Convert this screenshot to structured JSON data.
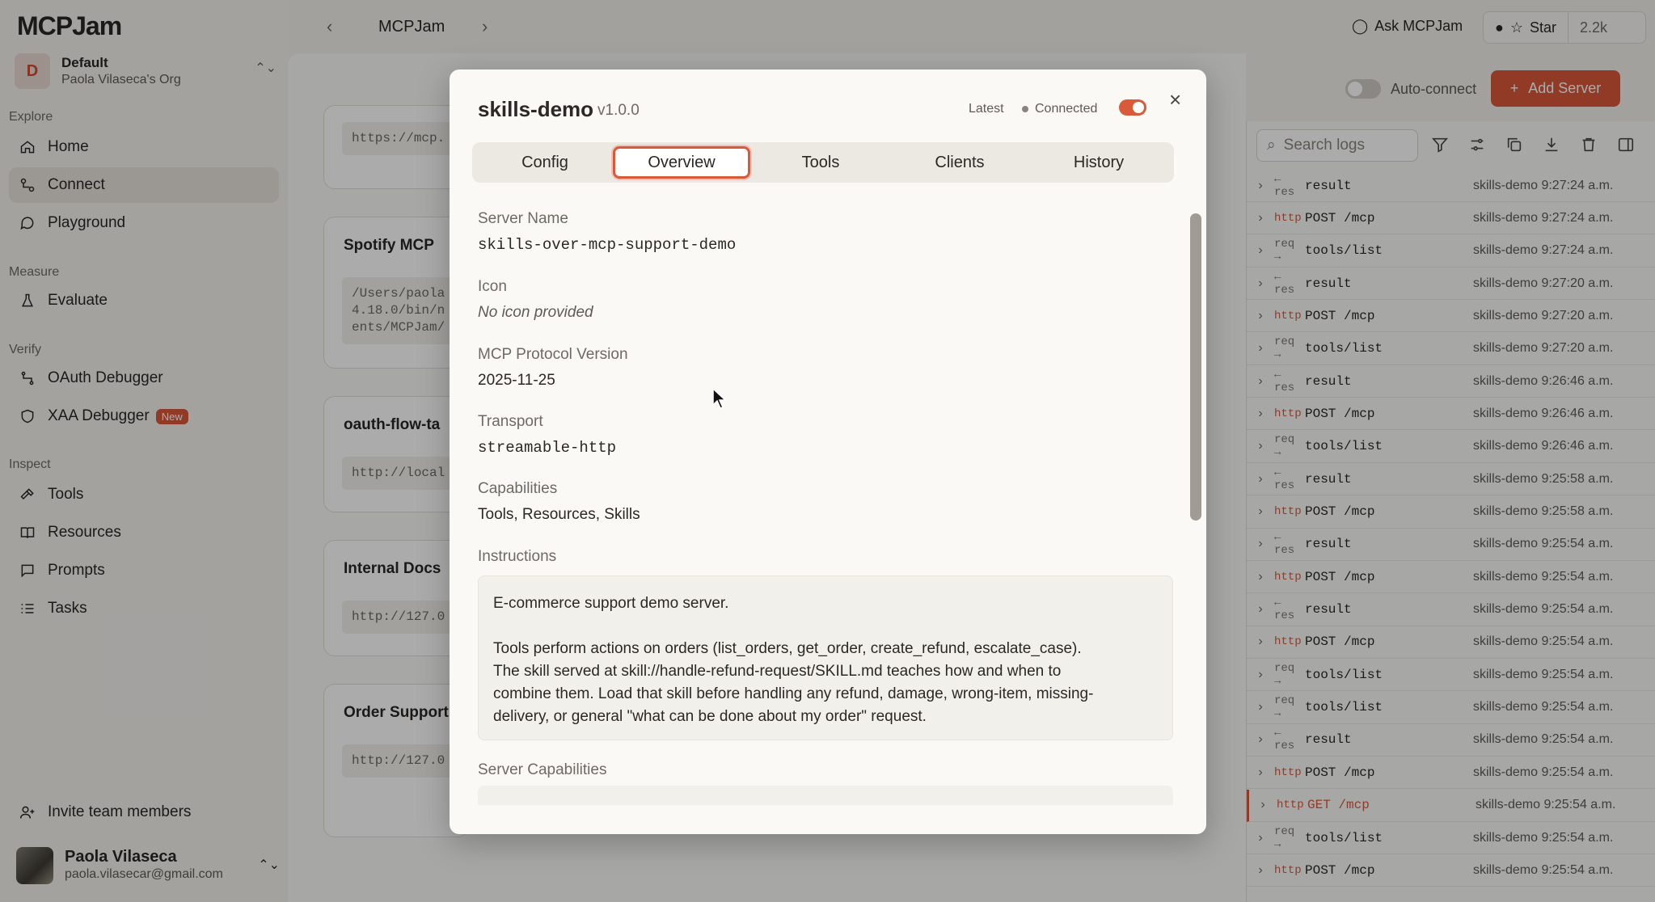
{
  "app": {
    "logo": "MCPJam",
    "org": {
      "initial": "D",
      "name": "Default",
      "owner": "Paola Vilaseca's Org"
    },
    "nav": {
      "explore_label": "Explore",
      "home": "Home",
      "connect": "Connect",
      "playground": "Playground",
      "measure_label": "Measure",
      "evaluate": "Evaluate",
      "verify_label": "Verify",
      "oauth_debugger": "OAuth Debugger",
      "xaa_debugger": "XAA Debugger",
      "new_badge": "New",
      "inspect_label": "Inspect",
      "tools": "Tools",
      "resources": "Resources",
      "prompts": "Prompts",
      "tasks": "Tasks",
      "invite": "Invite team members"
    },
    "user": {
      "name": "Paola Vilaseca",
      "email": "paola.vilasecar@gmail.com"
    }
  },
  "topbar": {
    "breadcrumb": "MCPJam",
    "ask_label": "Ask MCPJam",
    "star_label": "Star",
    "star_count": "2.2k"
  },
  "main": {
    "auto_connect_label": "Auto-connect",
    "add_server_label": "Add Server",
    "cards": [
      {
        "title": "",
        "code": "https://mcp."
      },
      {
        "title": "Spotify MCP",
        "code": "/Users/paola\n4.18.0/bin/n\nents/MCPJam/"
      },
      {
        "title": "oauth-flow-ta",
        "code": "http://local"
      },
      {
        "title": "Internal Docs",
        "code": "http://127.0"
      },
      {
        "title": "Order Support",
        "code": "http://127.0"
      }
    ]
  },
  "modal": {
    "server_title": "skills-demo",
    "version": "v1.0.0",
    "latest_label": "Latest",
    "status_label": "Connected",
    "tabs": [
      "Config",
      "Overview",
      "Tools",
      "Clients",
      "History"
    ],
    "active_tab": "Overview",
    "fields": {
      "server_name_label": "Server Name",
      "server_name": "skills-over-mcp-support-demo",
      "icon_label": "Icon",
      "icon_value": "No icon provided",
      "protocol_label": "MCP Protocol Version",
      "protocol_value": "2025-11-25",
      "transport_label": "Transport",
      "transport_value": "streamable-http",
      "capabilities_label": "Capabilities",
      "capabilities_value": "Tools, Resources, Skills",
      "instructions_label": "Instructions",
      "instructions_line1": "E-commerce support demo server.",
      "instructions_line2": "Tools perform actions on orders (list_orders, get_order, create_refund, escalate_case).",
      "instructions_line3": "The skill served at skill://handle-refund-request/SKILL.md teaches how and when to",
      "instructions_line4": "combine them. Load that skill before handling any refund, damage, wrong-item, missing-",
      "instructions_line5": "delivery, or general \"what can be done about my order\" request.",
      "server_capabilities_label": "Server Capabilities"
    }
  },
  "logs": {
    "search_placeholder": "Search logs",
    "rows": [
      {
        "kind": "← res",
        "msg": "result",
        "src": "skills-demo 9:27:24 a.m."
      },
      {
        "kind": "http",
        "msg": "POST /mcp",
        "src": "skills-demo 9:27:24 a.m."
      },
      {
        "kind": "req →",
        "msg": "tools/list",
        "src": "skills-demo 9:27:24 a.m."
      },
      {
        "kind": "← res",
        "msg": "result",
        "src": "skills-demo 9:27:20 a.m."
      },
      {
        "kind": "http",
        "msg": "POST /mcp",
        "src": "skills-demo 9:27:20 a.m."
      },
      {
        "kind": "req →",
        "msg": "tools/list",
        "src": "skills-demo 9:27:20 a.m."
      },
      {
        "kind": "← res",
        "msg": "result",
        "src": "skills-demo 9:26:46 a.m."
      },
      {
        "kind": "http",
        "msg": "POST /mcp",
        "src": "skills-demo 9:26:46 a.m."
      },
      {
        "kind": "req →",
        "msg": "tools/list",
        "src": "skills-demo 9:26:46 a.m."
      },
      {
        "kind": "← res",
        "msg": "result",
        "src": "skills-demo 9:25:58 a.m."
      },
      {
        "kind": "http",
        "msg": "POST /mcp",
        "src": "skills-demo 9:25:58 a.m."
      },
      {
        "kind": "← res",
        "msg": "result",
        "src": "skills-demo 9:25:54 a.m."
      },
      {
        "kind": "http",
        "msg": "POST /mcp",
        "src": "skills-demo 9:25:54 a.m."
      },
      {
        "kind": "← res",
        "msg": "result",
        "src": "skills-demo 9:25:54 a.m."
      },
      {
        "kind": "http",
        "msg": "POST /mcp",
        "src": "skills-demo 9:25:54 a.m."
      },
      {
        "kind": "req →",
        "msg": "tools/list",
        "src": "skills-demo 9:25:54 a.m."
      },
      {
        "kind": "req →",
        "msg": "tools/list",
        "src": "skills-demo 9:25:54 a.m."
      },
      {
        "kind": "← res",
        "msg": "result",
        "src": "skills-demo 9:25:54 a.m."
      },
      {
        "kind": "http",
        "msg": "POST /mcp",
        "src": "skills-demo 9:25:54 a.m."
      },
      {
        "kind": "http",
        "msg": "GET /mcp",
        "src": "skills-demo 9:25:54 a.m."
      },
      {
        "kind": "req →",
        "msg": "tools/list",
        "src": "skills-demo 9:25:54 a.m."
      },
      {
        "kind": "http",
        "msg": "POST /mcp",
        "src": "skills-demo 9:25:54 a.m."
      }
    ]
  },
  "colors": {
    "accent": "#d9593b",
    "background": "#f3f1ec"
  }
}
